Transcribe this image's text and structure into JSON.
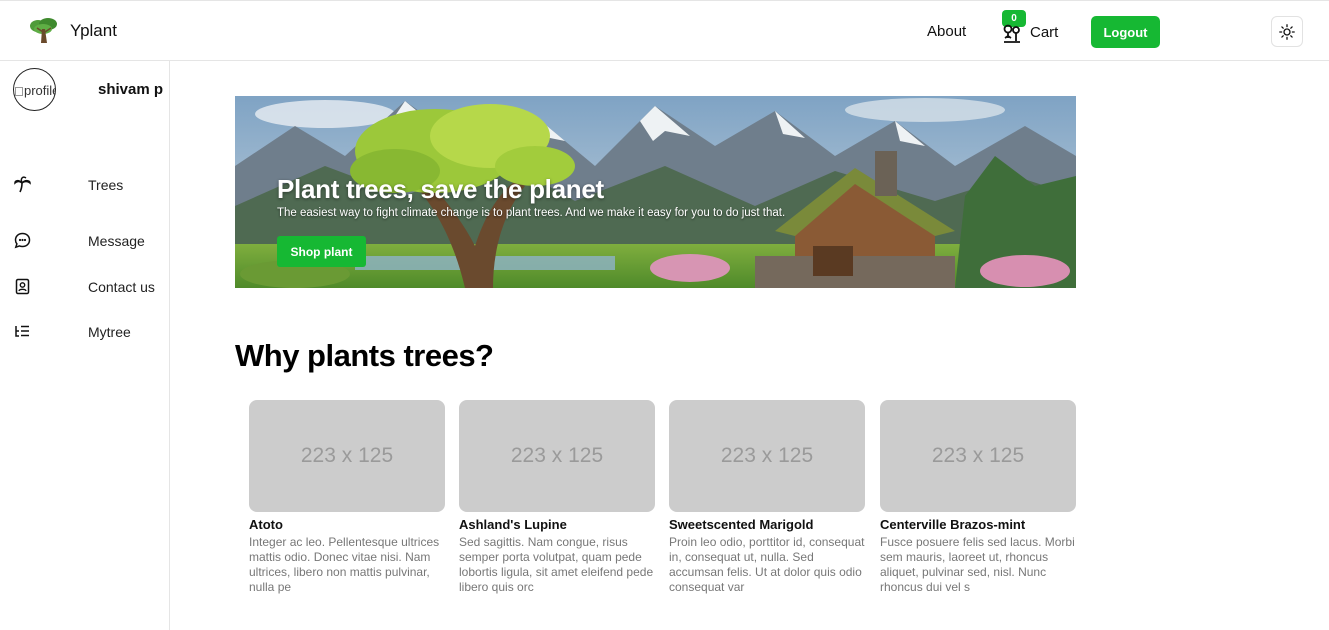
{
  "brand": {
    "name": "Yplant",
    "logo_icon": "tree-icon"
  },
  "nav": {
    "about_label": "About",
    "cart_label": "Cart",
    "cart_count": "0",
    "logout_label": "Logout",
    "theme_icon": "sun-icon"
  },
  "sidebar": {
    "avatar_alt": "profile",
    "username": "shivam p",
    "items": [
      {
        "label": "Trees",
        "icon": "palm-tree-icon"
      },
      {
        "label": "Message",
        "icon": "chat-bubble-icon"
      },
      {
        "label": "Contact us",
        "icon": "contact-card-icon"
      },
      {
        "label": "Mytree",
        "icon": "tree-list-icon"
      }
    ]
  },
  "hero": {
    "title": "Plant trees, save the planet",
    "subtitle": "The easiest way to fight climate change is to plant trees. And we make it easy for you to do just that.",
    "button_label": "Shop plant"
  },
  "section": {
    "title": "Why plants trees?",
    "cards": [
      {
        "placeholder": "223 x 125",
        "title": "Atoto",
        "text": "Integer ac leo. Pellentesque ultrices mattis odio. Donec vitae nisi. Nam ultrices, libero non mattis pulvinar, nulla pe"
      },
      {
        "placeholder": "223 x 125",
        "title": "Ashland's Lupine",
        "text": "Sed sagittis. Nam congue, risus semper porta volutpat, quam pede lobortis ligula, sit amet eleifend pede libero quis orc"
      },
      {
        "placeholder": "223 x 125",
        "title": "Sweetscented Marigold",
        "text": "Proin leo odio, porttitor id, consequat in, consequat ut, nulla. Sed accumsan felis. Ut at dolor quis odio consequat var"
      },
      {
        "placeholder": "223 x 125",
        "title": "Centerville Brazos-mint",
        "text": "Fusce posuere felis sed lacus. Morbi sem mauris, laoreet ut, rhoncus aliquet, pulvinar sed, nisl. Nunc rhoncus dui vel s"
      }
    ]
  },
  "colors": {
    "accent": "#16b833",
    "placeholder_bg": "#cccccc"
  }
}
